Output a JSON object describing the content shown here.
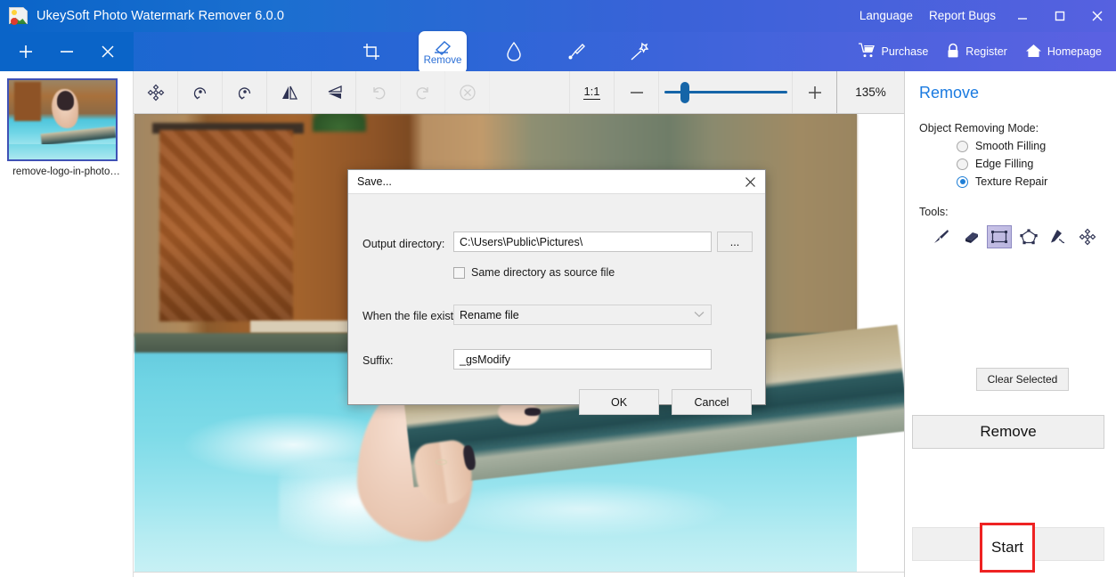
{
  "titlebar": {
    "app_title": "UkeySoft Photo Watermark Remover 6.0.0",
    "language": "Language",
    "report_bugs": "Report Bugs",
    "minimize": "minimize",
    "maximize": "maximize",
    "close": "close"
  },
  "ribbon": {
    "tools": [
      {
        "name": "crop",
        "label": ""
      },
      {
        "name": "remove",
        "label": "Remove"
      },
      {
        "name": "watermark-drop",
        "label": ""
      },
      {
        "name": "brush",
        "label": ""
      },
      {
        "name": "magic-wand",
        "label": ""
      }
    ],
    "links": [
      {
        "name": "purchase",
        "label": "Purchase"
      },
      {
        "name": "register",
        "label": "Register"
      },
      {
        "name": "homepage",
        "label": "Homepage"
      }
    ]
  },
  "left_panel": {
    "add_label": "+",
    "remove_label": "−",
    "clear_label": "×",
    "thumbnail_name": "remove-logo-in-photo…"
  },
  "toolbar2": {
    "buttons": [
      {
        "name": "move",
        "enabled": true
      },
      {
        "name": "rotate-left",
        "enabled": true
      },
      {
        "name": "rotate-right",
        "enabled": true
      },
      {
        "name": "flip-horizontal",
        "enabled": true
      },
      {
        "name": "flip-vertical",
        "enabled": true
      },
      {
        "name": "undo",
        "enabled": false
      },
      {
        "name": "redo",
        "enabled": false
      },
      {
        "name": "reset",
        "enabled": false
      }
    ],
    "fit_label": "1:1",
    "zoom_out_label": "−",
    "zoom_in_label": "+",
    "zoom_percent": "135%",
    "zoom_value": 17
  },
  "right_panel": {
    "title": "Remove",
    "mode_label": "Object Removing Mode:",
    "modes": [
      {
        "label": "Smooth Filling",
        "selected": false
      },
      {
        "label": "Edge Filling",
        "selected": false
      },
      {
        "label": "Texture Repair",
        "selected": true
      }
    ],
    "tools_label": "Tools:",
    "tools": [
      {
        "name": "brush-tool",
        "selected": false
      },
      {
        "name": "eraser-tool",
        "selected": false
      },
      {
        "name": "rectangle-select-tool",
        "selected": true
      },
      {
        "name": "polygon-select-tool",
        "selected": false
      },
      {
        "name": "pen-tool",
        "selected": false
      },
      {
        "name": "move-tool",
        "selected": false
      }
    ],
    "clear_selected_label": "Clear Selected",
    "remove_label": "Remove",
    "start_label": "Start"
  },
  "dialog": {
    "title": "Save...",
    "close_label": "×",
    "output_directory_label": "Output directory:",
    "output_directory_value": "C:\\Users\\Public\\Pictures\\",
    "browse_label": "...",
    "same_directory_label": "Same directory as source file",
    "same_directory_checked": false,
    "when_exists_label": "When the file exists:",
    "when_exists_value": "Rename file",
    "suffix_label": "Suffix:",
    "suffix_value": "_gsModify",
    "ok_label": "OK",
    "cancel_label": "Cancel"
  },
  "colors": {
    "title_start": "#0a64c8",
    "title_end": "#5b61e2",
    "accent_blue": "#1a7ae0",
    "highlight_red": "#ee2222",
    "slider_blue": "#1565a8"
  }
}
